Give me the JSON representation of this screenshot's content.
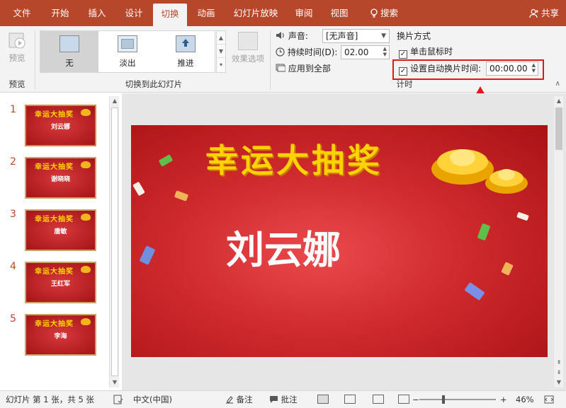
{
  "ribbon_tabs": [
    {
      "label": "文件"
    },
    {
      "label": "开始"
    },
    {
      "label": "插入"
    },
    {
      "label": "设计"
    },
    {
      "label": "切换"
    },
    {
      "label": "动画"
    },
    {
      "label": "幻灯片放映"
    },
    {
      "label": "审阅"
    },
    {
      "label": "视图"
    },
    {
      "label": "搜索"
    }
  ],
  "active_tab": "切换",
  "share_label": "共享",
  "ribbon": {
    "preview": {
      "button_label": "预览",
      "group_label": "预览"
    },
    "transitions": {
      "items": [
        {
          "label": "无",
          "selected": true
        },
        {
          "label": "淡出",
          "selected": false
        },
        {
          "label": "推进",
          "selected": false
        }
      ],
      "effect_options_label": "效果选项",
      "group_label": "切换到此幻灯片"
    },
    "timing": {
      "sound_label": "声音:",
      "sound_value": "[无声音]",
      "duration_label": "持续时间(D):",
      "duration_value": "02.00",
      "apply_all_label": "应用到全部",
      "advance_heading": "换片方式",
      "on_click_label": "单击鼠标时",
      "on_click_checked": true,
      "after_label": "设置自动换片时间:",
      "after_checked": true,
      "after_value": "00:00.00",
      "group_label": "计时"
    }
  },
  "slides": [
    {
      "number": "1",
      "title": "幸运大抽奖",
      "name": "刘云娜"
    },
    {
      "number": "2",
      "title": "幸运大抽奖",
      "name": "谢晓晓"
    },
    {
      "number": "3",
      "title": "幸运大抽奖",
      "name": "唐敏"
    },
    {
      "number": "4",
      "title": "幸运大抽奖",
      "name": "王红军"
    },
    {
      "number": "5",
      "title": "幸运大抽奖",
      "name": "李海"
    }
  ],
  "current_slide": {
    "title": "幸运大抽奖",
    "name": "刘云娜"
  },
  "status_bar": {
    "slide_info": "幻灯片 第 1 张，共 5 张",
    "language": "中文(中国)",
    "notes_label": "备注",
    "comments_label": "批注",
    "zoom": "46%"
  },
  "colors": {
    "accent": "#b7472a",
    "highlight_box": "#e01818",
    "slide_bg": "#cf2a2d",
    "title_gold": "#ffd200"
  },
  "icons": [
    "preview-icon",
    "sound-icon",
    "clock-icon",
    "apply-all-icon",
    "search-icon",
    "share-person-icon",
    "checkbox-icon",
    "notes-icon",
    "comments-icon",
    "normal-view-icon",
    "slide-sorter-icon",
    "reading-view-icon",
    "slideshow-icon",
    "fit-window-icon"
  ]
}
